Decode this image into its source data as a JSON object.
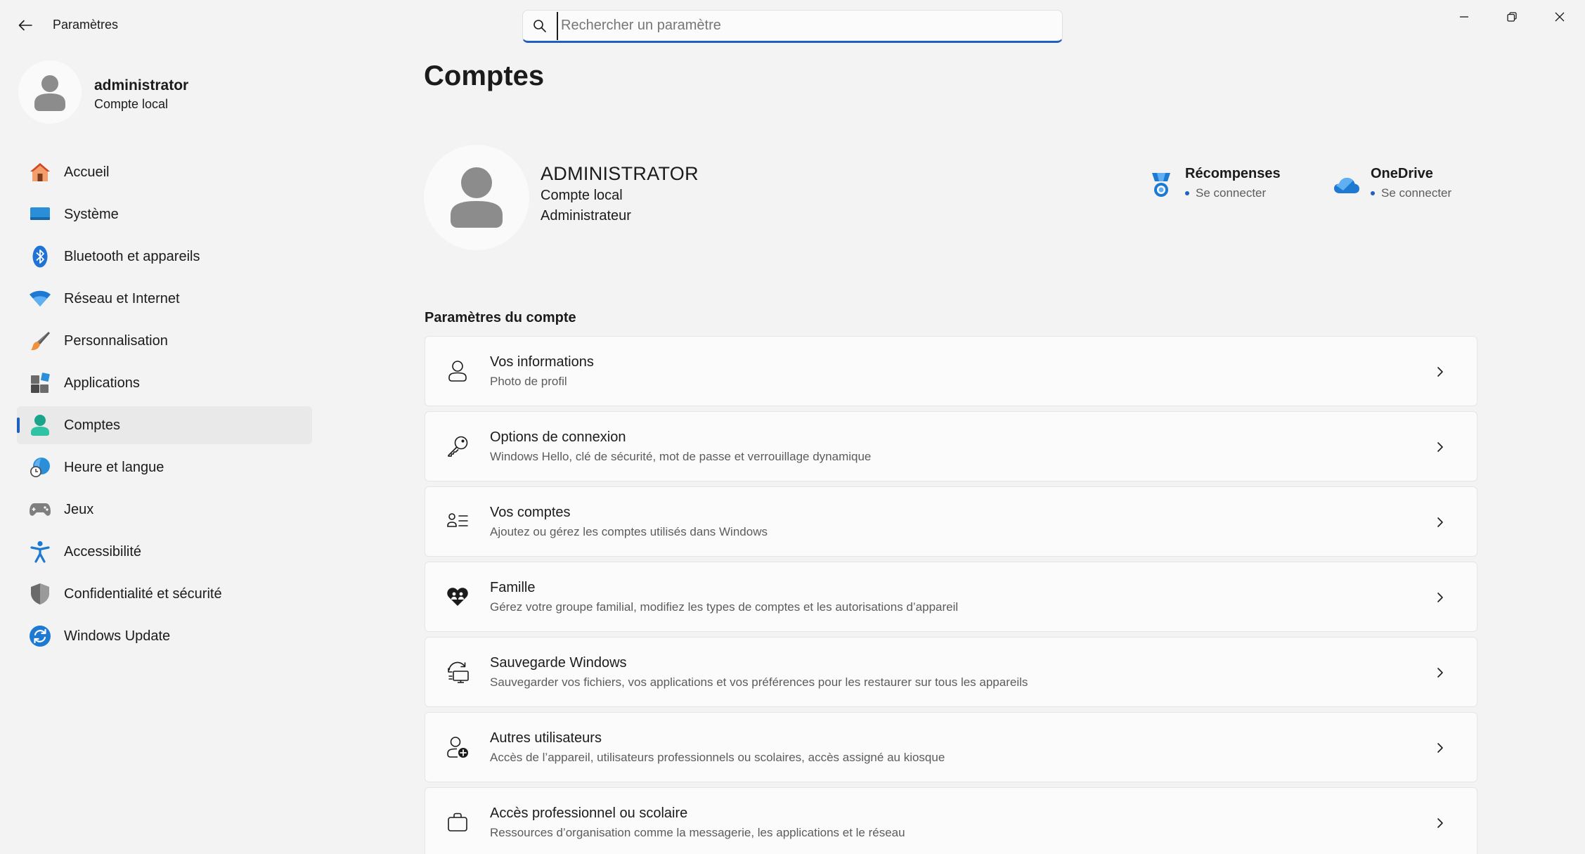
{
  "titlebar": {
    "app_title": "Paramètres",
    "search_placeholder": "Rechercher un paramètre"
  },
  "profile": {
    "name": "administrator",
    "type": "Compte local"
  },
  "nav": {
    "items": [
      {
        "label": "Accueil",
        "icon": "home-icon"
      },
      {
        "label": "Système",
        "icon": "system-icon"
      },
      {
        "label": "Bluetooth et appareils",
        "icon": "bluetooth-icon"
      },
      {
        "label": "Réseau et Internet",
        "icon": "wifi-icon"
      },
      {
        "label": "Personnalisation",
        "icon": "brush-icon"
      },
      {
        "label": "Applications",
        "icon": "apps-icon"
      },
      {
        "label": "Comptes",
        "icon": "accounts-icon"
      },
      {
        "label": "Heure et langue",
        "icon": "clock-globe-icon"
      },
      {
        "label": "Jeux",
        "icon": "gamepad-icon"
      },
      {
        "label": "Accessibilité",
        "icon": "accessibility-icon"
      },
      {
        "label": "Confidentialité et sécurité",
        "icon": "shield-icon"
      },
      {
        "label": "Windows Update",
        "icon": "update-icon"
      }
    ],
    "active": "Comptes"
  },
  "main": {
    "title": "Comptes",
    "hero": {
      "name": "ADMINISTRATOR",
      "line1": "Compte local",
      "line2": "Administrateur"
    },
    "services": [
      {
        "title": "Récompenses",
        "status": "Se connecter",
        "icon": "rewards-icon"
      },
      {
        "title": "OneDrive",
        "status": "Se connecter",
        "icon": "onedrive-icon"
      }
    ],
    "section_title": "Paramètres du compte",
    "cards": [
      {
        "title": "Vos informations",
        "subtitle": "Photo de profil",
        "icon": "person-icon"
      },
      {
        "title": "Options de connexion",
        "subtitle": "Windows Hello, clé de sécurité, mot de passe et verrouillage dynamique",
        "icon": "key-icon"
      },
      {
        "title": "Vos comptes",
        "subtitle": "Ajoutez ou gérez les comptes utilisés dans Windows",
        "icon": "people-list-icon"
      },
      {
        "title": "Famille",
        "subtitle": "Gérez votre groupe familial, modifiez les types de comptes et les autorisations d’appareil",
        "icon": "family-heart-icon"
      },
      {
        "title": "Sauvegarde Windows",
        "subtitle": "Sauvegarder vos fichiers, vos applications et vos préférences pour les restaurer sur tous les appareils",
        "icon": "backup-icon"
      },
      {
        "title": "Autres utilisateurs",
        "subtitle": "Accès de l’appareil, utilisateurs professionnels ou scolaires, accès assigné au kiosque",
        "icon": "add-person-icon"
      },
      {
        "title": "Accès professionnel ou scolaire",
        "subtitle": "Ressources d’organisation comme la messagerie, les applications et le réseau",
        "icon": "briefcase-icon"
      }
    ]
  },
  "colors": {
    "accent": "#1f5fbf",
    "background": "#f3f3f3",
    "card": "#fbfbfb"
  }
}
